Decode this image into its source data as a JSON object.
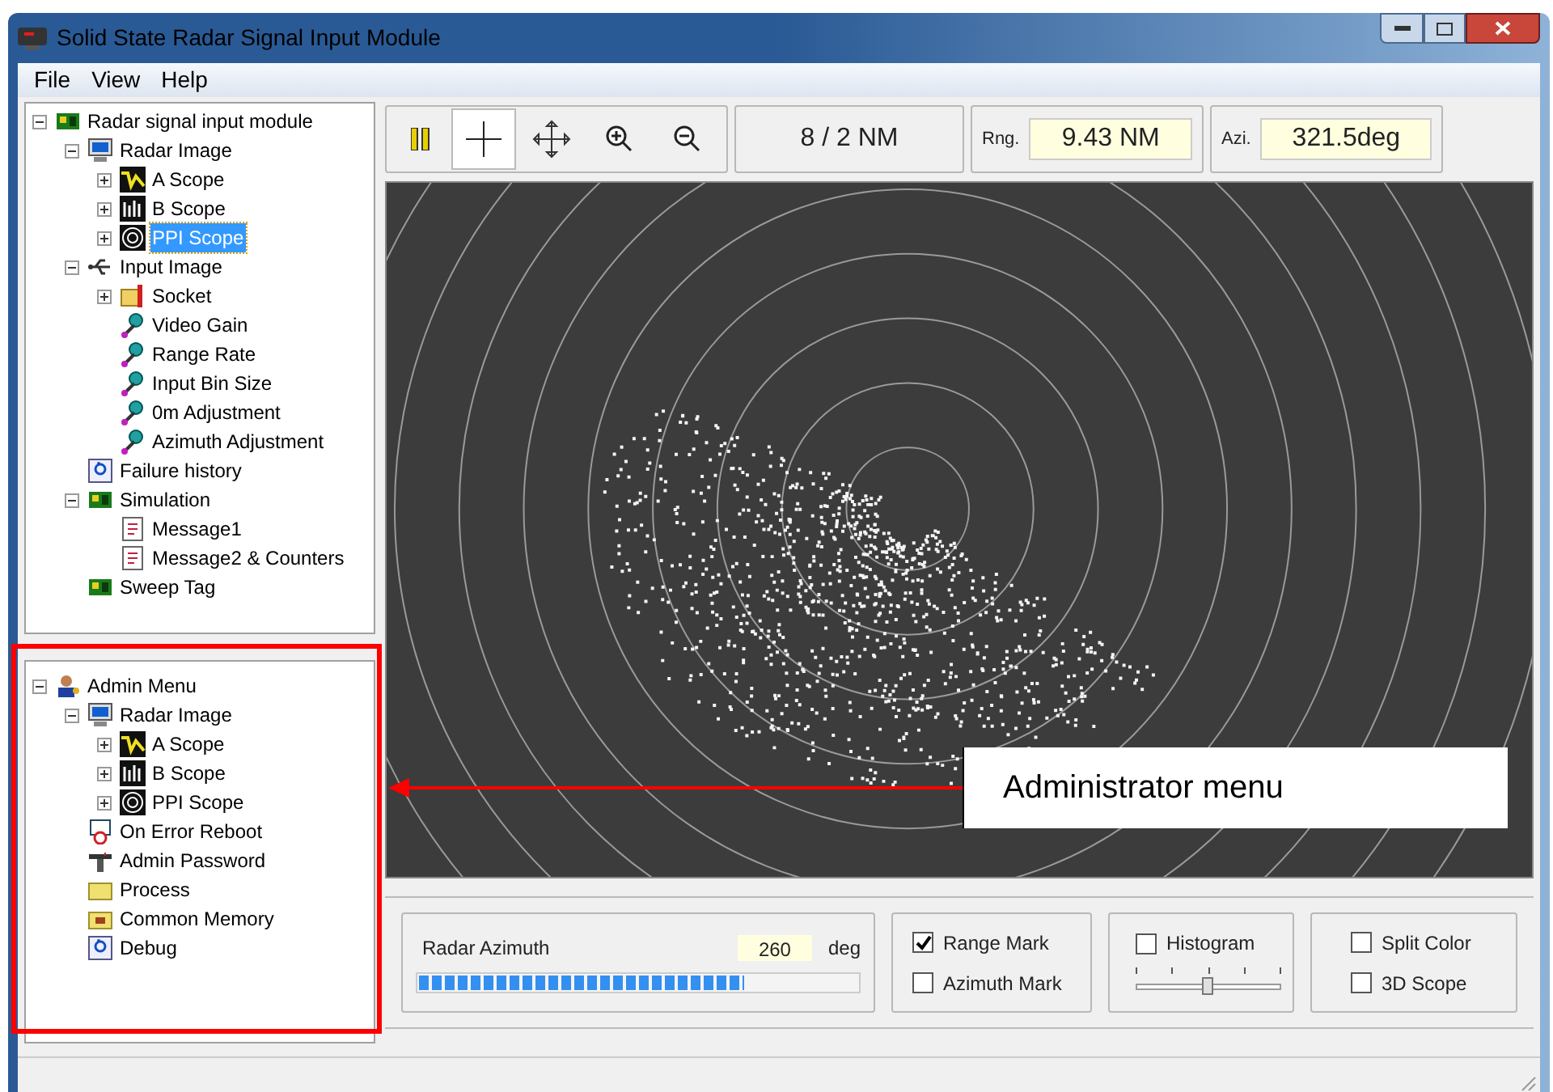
{
  "window": {
    "title": "Solid State Radar Signal Input Module"
  },
  "menu": [
    "File",
    "View",
    "Help"
  ],
  "tree_top": [
    {
      "label": "Radar signal input module",
      "kind": "module",
      "expanded": true,
      "selected": false,
      "children": [
        {
          "label": "Radar Image",
          "kind": "monitor",
          "expanded": true,
          "selected": false,
          "children": [
            {
              "label": "A Scope",
              "kind": "ascope",
              "expanded": false,
              "selected": false
            },
            {
              "label": "B Scope",
              "kind": "bscope",
              "expanded": false,
              "selected": false
            },
            {
              "label": "PPI Scope",
              "kind": "ppi",
              "expanded": false,
              "selected": true
            }
          ]
        },
        {
          "label": "Input Image",
          "kind": "usb",
          "expanded": true,
          "selected": false,
          "children": [
            {
              "label": "Socket",
              "kind": "tools",
              "expanded": false,
              "selected": false
            },
            {
              "label": "Video Gain",
              "kind": "gauge",
              "selected": false
            },
            {
              "label": "Range Rate",
              "kind": "gauge",
              "selected": false
            },
            {
              "label": "Input Bin Size",
              "kind": "gauge",
              "selected": false
            },
            {
              "label": "0m Adjustment",
              "kind": "gauge",
              "selected": false
            },
            {
              "label": "Azimuth Adjustment",
              "kind": "gauge",
              "selected": false
            }
          ]
        },
        {
          "label": "Failure history",
          "kind": "access",
          "selected": false
        },
        {
          "label": "Simulation",
          "kind": "module",
          "expanded": true,
          "selected": false,
          "children": [
            {
              "label": "Message1",
              "kind": "message",
              "selected": false
            },
            {
              "label": "Message2 & Counters",
              "kind": "message",
              "selected": false
            }
          ]
        },
        {
          "label": "Sweep Tag",
          "kind": "module",
          "selected": false
        }
      ]
    }
  ],
  "tree_admin": [
    {
      "label": "Admin Menu",
      "kind": "user",
      "expanded": true,
      "selected": false,
      "children": [
        {
          "label": "Radar Image",
          "kind": "monitor",
          "expanded": true,
          "selected": false,
          "children": [
            {
              "label": "A Scope",
              "kind": "ascope",
              "expanded": false,
              "selected": false
            },
            {
              "label": "B Scope",
              "kind": "bscope",
              "expanded": false,
              "selected": false
            },
            {
              "label": "PPI Scope",
              "kind": "ppi",
              "expanded": false,
              "selected": false
            }
          ]
        },
        {
          "label": "On Error Reboot",
          "kind": "reboot",
          "selected": false
        },
        {
          "label": "Admin Password",
          "kind": "password",
          "selected": false
        },
        {
          "label": "Process",
          "kind": "folder",
          "selected": false
        },
        {
          "label": "Common Memory",
          "kind": "memory",
          "selected": false
        },
        {
          "label": "Debug",
          "kind": "access",
          "selected": false
        }
      ]
    }
  ],
  "toolbar": {
    "scale": "8 / 2 NM",
    "range_label": "Rng.",
    "range_value": "9.43 NM",
    "azimuth_label": "Azi.",
    "azimuth_value": "321.5deg"
  },
  "controls": {
    "azimuth_label": "Radar Azimuth",
    "azimuth_value": "260",
    "azimuth_unit": "deg",
    "azimuth_bar": {
      "level": 0.74
    },
    "checks": [
      {
        "label": "Range Mark",
        "checked": true
      },
      {
        "label": "Azimuth Mark",
        "checked": false
      }
    ],
    "histogram": {
      "label": "Histogram",
      "checked": false,
      "level": 0.5
    },
    "scope_checks": [
      {
        "label": "Split Color",
        "checked": false
      },
      {
        "label": "3D Scope",
        "checked": false
      }
    ]
  },
  "annotation": {
    "text": "Administrator menu"
  }
}
